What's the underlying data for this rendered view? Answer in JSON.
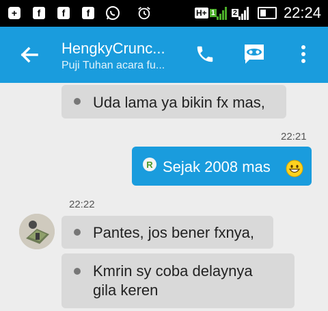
{
  "status_bar": {
    "time": "22:24",
    "network_label": "H+",
    "sim1_index": "1",
    "sim2_index": "2",
    "notification_icons": [
      "plus-box-icon",
      "facebook-icon",
      "facebook-icon",
      "facebook-icon",
      "whatsapp-icon",
      "alarm-icon"
    ]
  },
  "header": {
    "contact_name": "HengkyCrunc...",
    "contact_status": "Puji Tuhan acara fu..."
  },
  "messages": [
    {
      "direction": "in",
      "text": "Uda lama ya bikin fx mas,"
    },
    {
      "direction": "out",
      "timestamp": "22:21",
      "badge": "R",
      "text": "Sejak 2008 mas"
    },
    {
      "direction": "in",
      "timestamp": "22:22",
      "text": "Pantes, jos bener fxnya,"
    },
    {
      "direction": "in",
      "text_line1": "Kmrin sy coba delaynya",
      "text_line2": "gila keren"
    }
  ],
  "colors": {
    "app_bar": "#1a9cdd",
    "status_bar": "#000000",
    "background": "#ededed",
    "incoming_bubble": "#d9d9d9",
    "outgoing_bubble": "#1a9cdd",
    "signal_green": "#4caf2a"
  }
}
